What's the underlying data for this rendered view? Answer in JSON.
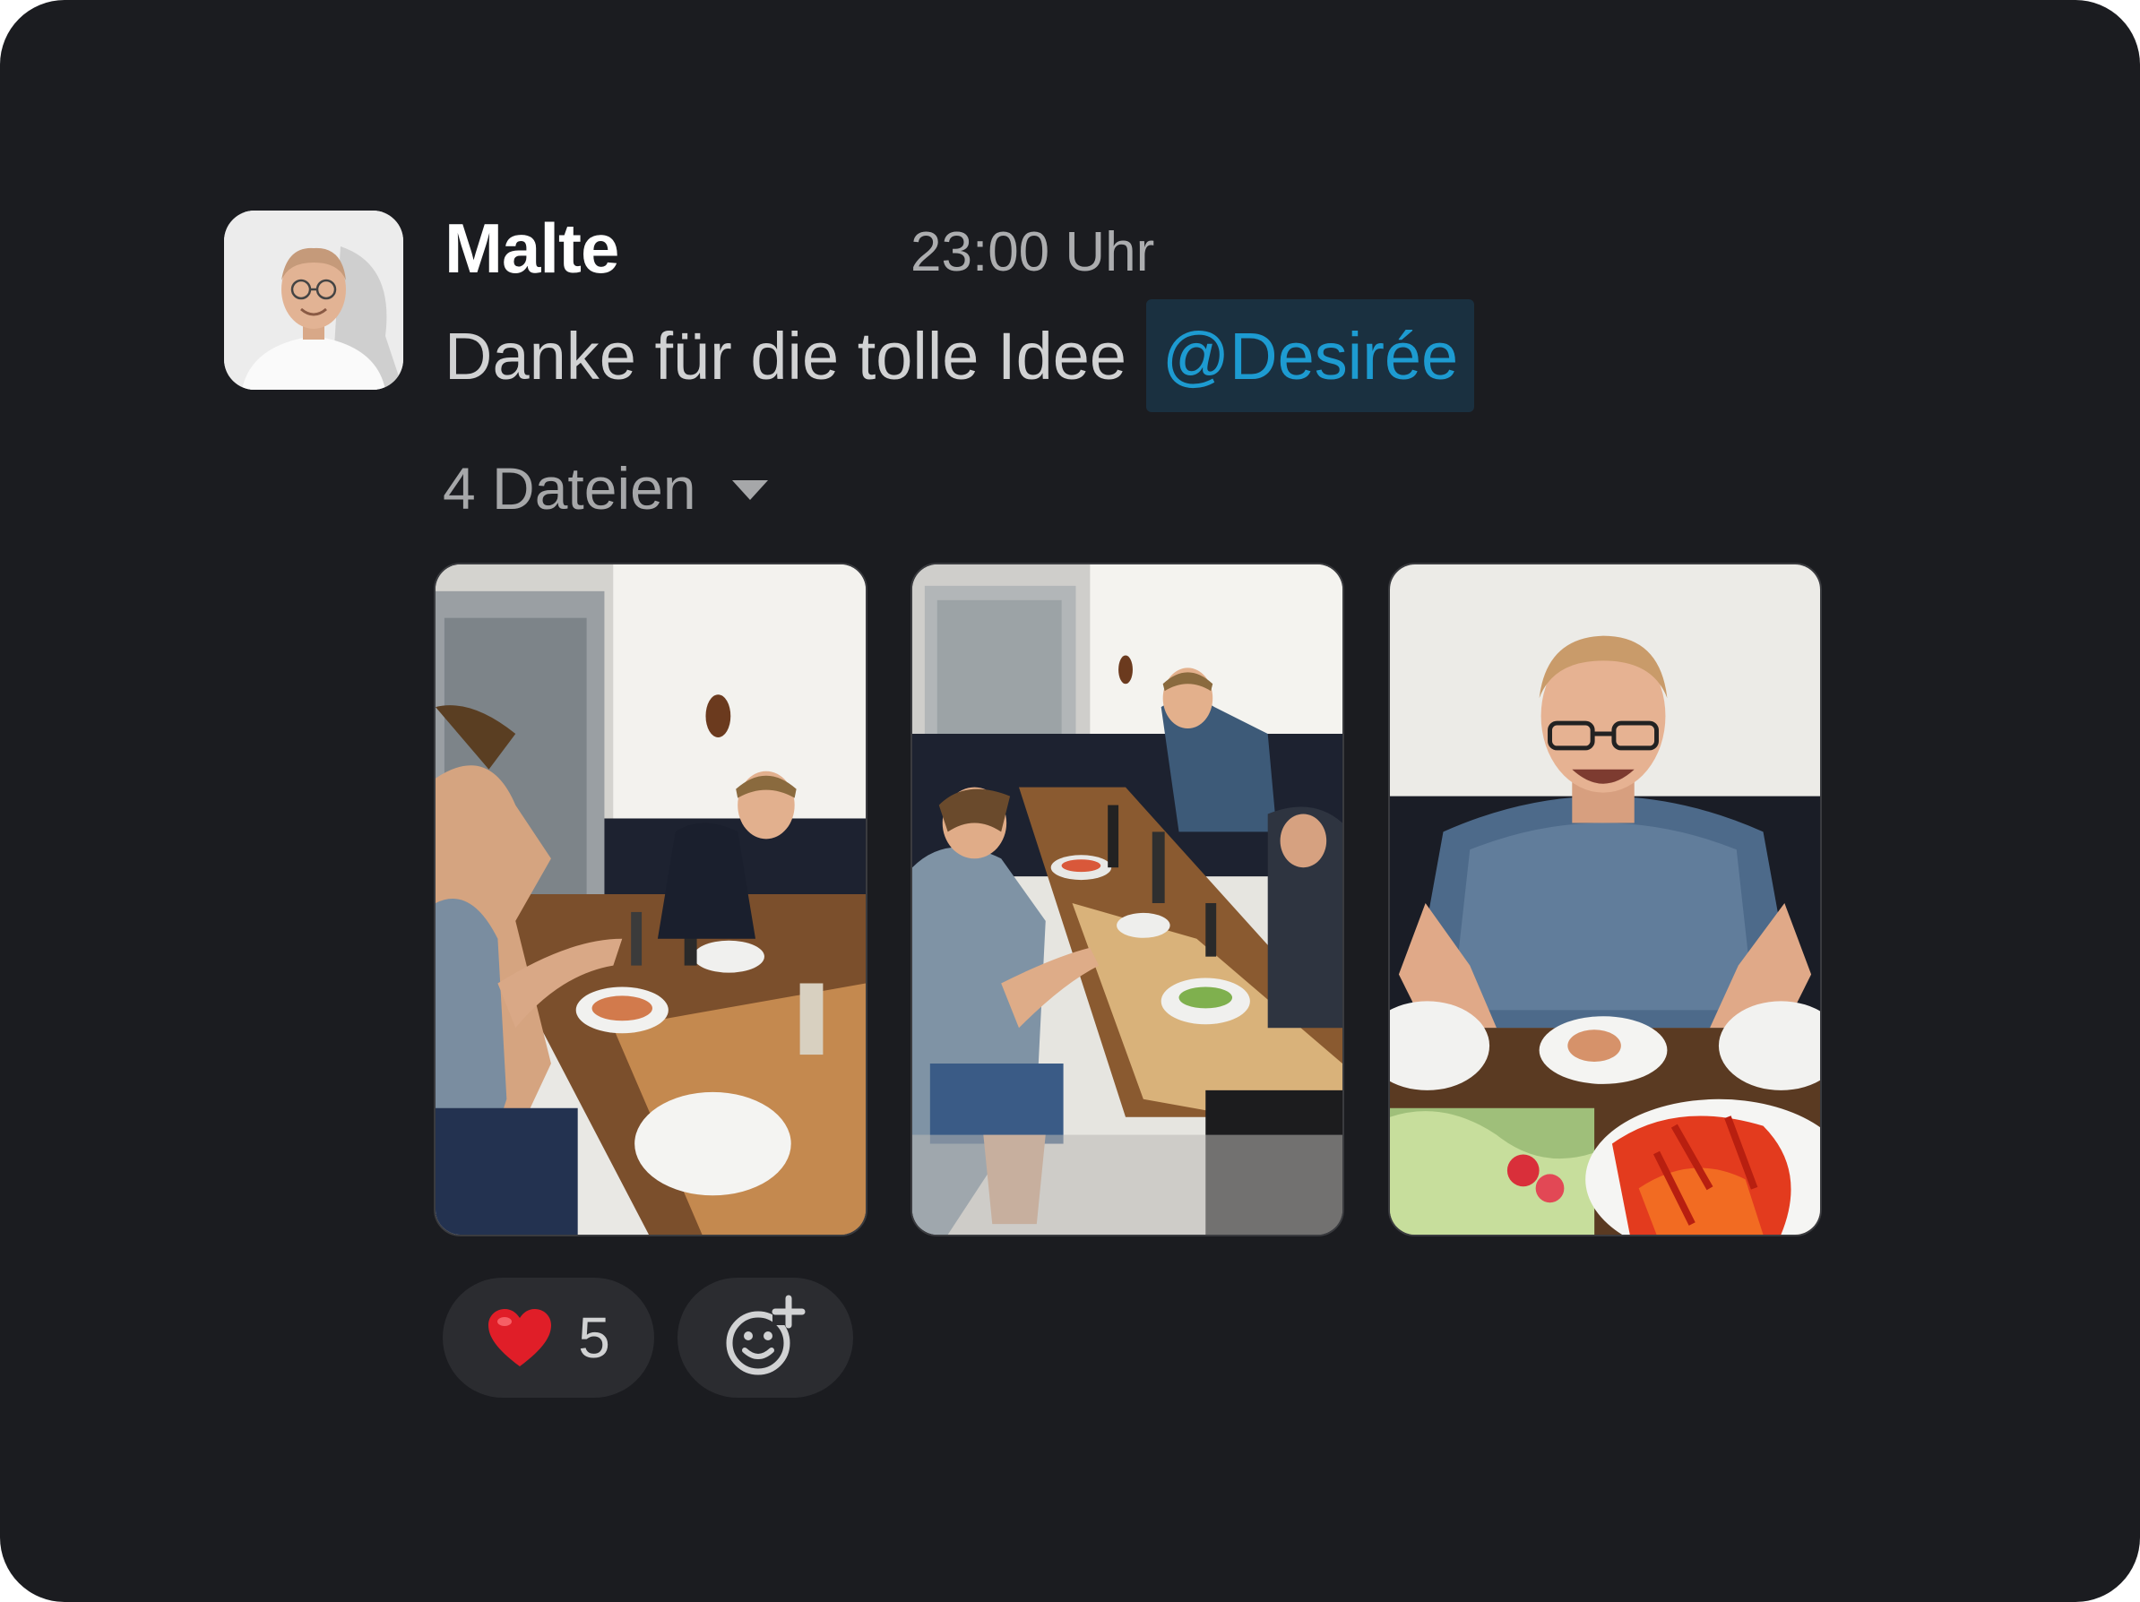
{
  "message": {
    "author": "Malte",
    "time": "23:00 Uhr",
    "text": "Danke für die tolle Idee",
    "mention": "@Desirée",
    "files_label": "4 Dateien"
  },
  "attachments": [
    {
      "icon": "photo-dinner-table-two-people"
    },
    {
      "icon": "photo-dinner-table-group"
    },
    {
      "icon": "photo-man-smiling-at-table"
    }
  ],
  "reactions": [
    {
      "emoji": "❤️",
      "icon": "heart-icon",
      "count": "5"
    }
  ],
  "add_reaction": {
    "icon": "add-reaction-icon"
  },
  "colors": {
    "background": "#1b1c20",
    "mention_bg": "#1a3040",
    "mention_text": "#1d9bd1",
    "reaction_bg": "#2b2c30"
  }
}
